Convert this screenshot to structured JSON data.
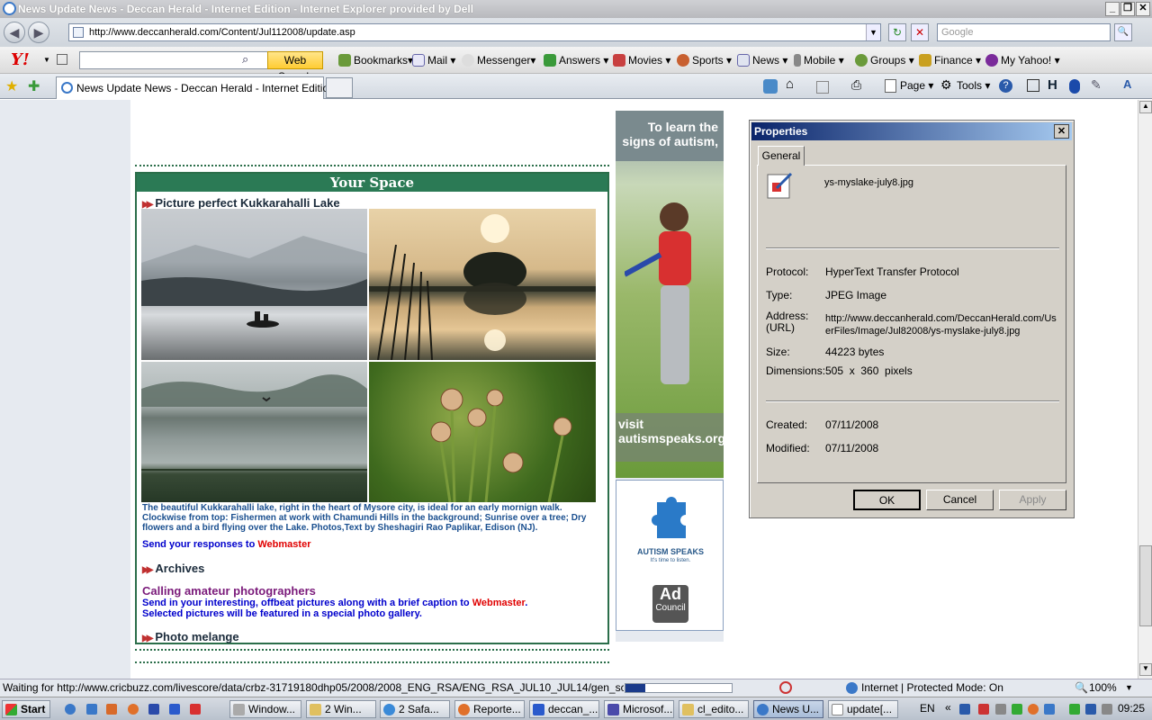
{
  "window": {
    "title": "News Update News - Deccan Herald - Internet Edition - Internet Explorer provided by Dell",
    "min_label": "_",
    "max_label": "❐",
    "close_label": "✕"
  },
  "navigation": {
    "back_label": "◀",
    "forward_label": "▶",
    "url": "http://www.deccanherald.com/Content/Jul112008/update.asp",
    "search_placeholder": "Google",
    "refresh_label": "↻",
    "stop_label": "✕",
    "search_go_label": "🔍"
  },
  "yahoo_toolbar": {
    "logo": "Y!",
    "web_search_label": "Web Search",
    "items": [
      "Bookmarks",
      "Mail",
      "Messenger",
      "Answers",
      "Movies",
      "Sports",
      "News",
      "Mobile",
      "Groups",
      "Finance",
      "My Yahoo!"
    ]
  },
  "tabs": {
    "active_tab": "News Update News - Deccan Herald - Internet Edition"
  },
  "command_bar": {
    "page_label": "Page",
    "tools_label": "Tools"
  },
  "page": {
    "your_space_title": "Your Space",
    "article_heading": "Picture perfect Kukkarahalli Lake",
    "caption": "The beautiful Kukkarahalli lake, right in the heart of Mysore city, is ideal for an early mornign walk. Clockwise from top: Fishermen at work with Chamundi Hills in the background; Sunrise over a tree; Dry flowers and a bird flying over the Lake. Photos,Text by Sheshagiri Rao Paplikar, Edison (NJ).",
    "send_responses_prefix": "Send your responses to ",
    "webmaster_link": "Webmaster",
    "archives_heading": "Archives",
    "calling_heading": "Calling amateur photographers",
    "calling_text_1": "Send in your interesting, offbeat pictures along with a brief caption to ",
    "calling_text_2": ".",
    "calling_text_3": "Selected pictures will be featured in a special photo gallery.",
    "photo_melange_heading": "Photo melange"
  },
  "ad": {
    "headline": "To learn the signs of autism,",
    "visit_text": "visit autismspeaks.org",
    "brand": "AUTISM SPEAKS",
    "tagline": "It's time to listen.",
    "council_line1": "Ad",
    "council_line2": "Council"
  },
  "dialog": {
    "title": "Properties",
    "tab_label": "General",
    "filename": "ys-myslake-july8.jpg",
    "protocol_label": "Protocol:",
    "protocol_value": "HyperText Transfer Protocol",
    "type_label": "Type:",
    "type_value": "JPEG Image",
    "address_label": "Address:",
    "address_label2": "(URL)",
    "address_value": "http://www.deccanherald.com/DeccanHerald.com/UserFiles/Image/Jul82008/ys-myslake-july8.jpg",
    "size_label": "Size:",
    "size_value": "44223 bytes",
    "dimensions_label": "Dimensions:",
    "dimensions_value": "505  x  360  pixels",
    "created_label": "Created:",
    "created_value": "07/11/2008",
    "modified_label": "Modified:",
    "modified_value": "07/11/2008",
    "ok_label": "OK",
    "cancel_label": "Cancel",
    "apply_label": "Apply"
  },
  "statusbar": {
    "message": "Waiting for http://www.cricbuzz.com/livescore/data/crbz-31719180dhp05/2008/2008_ENG_RSA/ENG_RSA_JUL10_JUL14/gen_scag.html...",
    "zone": "Internet | Protected Mode: On",
    "zoom": "100%"
  },
  "taskbar": {
    "start_label": "Start",
    "buttons": [
      "Window...",
      "2 Win...",
      "2 Safa...",
      "Reporte...",
      "deccan_...",
      "Microsof...",
      "cl_edito...",
      "News U...",
      "update[..."
    ],
    "language": "EN",
    "clock": "09:25"
  },
  "colors": {
    "your_space_green": "#2b7a55",
    "link_blue": "#0000cc",
    "link_red": "#e00000",
    "dialog_title_blue": "#0a246a"
  }
}
